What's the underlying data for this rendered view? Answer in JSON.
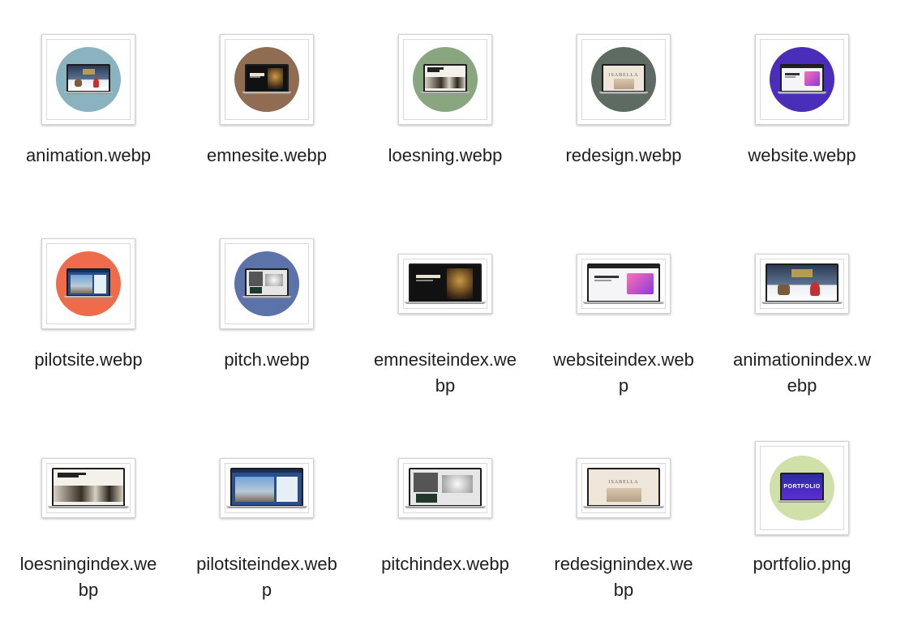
{
  "files": [
    {
      "name": "animation.webp",
      "label_lines": [
        "animation.webp"
      ],
      "circle_color": "#8ab3bf",
      "theme": "xmas"
    },
    {
      "name": "emnesite.webp",
      "label_lines": [
        "emnesite.webp"
      ],
      "circle_color": "#8f6c52",
      "theme": "dark-gold"
    },
    {
      "name": "loesning.webp",
      "label_lines": [
        "loesning.webp"
      ],
      "circle_color": "#8aa680",
      "theme": "light-photo"
    },
    {
      "name": "redesign.webp",
      "label_lines": [
        "redesign.webp"
      ],
      "circle_color": "#5e6b62",
      "theme": "beige",
      "screen_text": "ISABELLA"
    },
    {
      "name": "website.webp",
      "label_lines": [
        "website.webp"
      ],
      "circle_color": "#4a2db8",
      "theme": "product"
    },
    {
      "name": "pilotsite.webp",
      "label_lines": [
        "pilotsite.webp"
      ],
      "circle_color": "#ee6c4a",
      "theme": "blue-photo"
    },
    {
      "name": "pitch.webp",
      "label_lines": [
        "pitch.webp"
      ],
      "circle_color": "#5b73a8",
      "theme": "grey-collage"
    },
    {
      "name": "emnesiteindex.webp",
      "label_lines": [
        "emnesiteindex.we",
        "bp"
      ],
      "circle_color": "",
      "theme": "dark-gold"
    },
    {
      "name": "websiteindex.webp",
      "label_lines": [
        "websiteindex.web",
        "p"
      ],
      "circle_color": "",
      "theme": "product"
    },
    {
      "name": "animationindex.webp",
      "label_lines": [
        "animationindex.w",
        "ebp"
      ],
      "circle_color": "",
      "theme": "xmas"
    },
    {
      "name": "loesningindex.webp",
      "label_lines": [
        "loesningindex.we",
        "bp"
      ],
      "circle_color": "",
      "theme": "light-photo"
    },
    {
      "name": "pilotsiteindex.webp",
      "label_lines": [
        "pilotsiteindex.web",
        "p"
      ],
      "circle_color": "",
      "theme": "blue-photo"
    },
    {
      "name": "pitchindex.webp",
      "label_lines": [
        "pitchindex.webp"
      ],
      "circle_color": "",
      "theme": "grey-collage"
    },
    {
      "name": "redesignindex.webp",
      "label_lines": [
        "redesignindex.we",
        "bp"
      ],
      "circle_color": "",
      "theme": "beige",
      "screen_text": "ISABELLA"
    },
    {
      "name": "portfolio.png",
      "label_lines": [
        "portfolio.png"
      ],
      "circle_color": "#cfe0a8",
      "theme": "portfolio",
      "screen_text": "PORTFOLIO"
    }
  ]
}
